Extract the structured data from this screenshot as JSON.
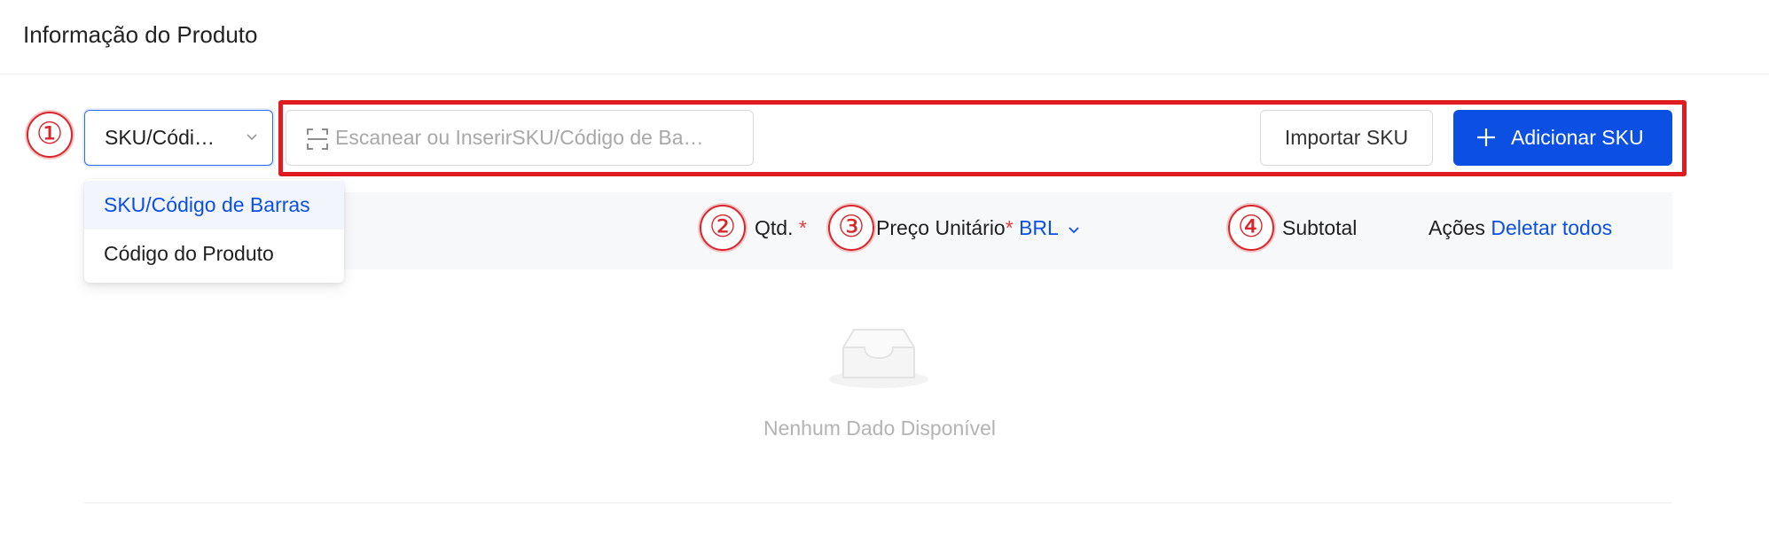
{
  "card": {
    "title": "Informação do Produto"
  },
  "markers": [
    "①",
    "②",
    "③",
    "④"
  ],
  "search_type_select": {
    "value": "SKU/Códi…",
    "options": [
      "SKU/Código de Barras",
      "Código do Produto"
    ]
  },
  "search": {
    "placeholder": "Escanear ou InserirSKU/Código de Ba…"
  },
  "buttons": {
    "import": "Importar SKU",
    "add": "Adicionar SKU"
  },
  "table": {
    "columns": {
      "qty": "Qtd.",
      "unit_price": "Preço Unitário",
      "currency": "BRL",
      "subtotal": "Subtotal",
      "actions": "Ações",
      "delete_all": "Deletar todos"
    },
    "required_mark": "*",
    "empty_text": "Nenhum Dado Disponível"
  },
  "colors": {
    "primary": "#0b4fe3",
    "highlight": "#e01b22",
    "required": "#e23a3a"
  }
}
